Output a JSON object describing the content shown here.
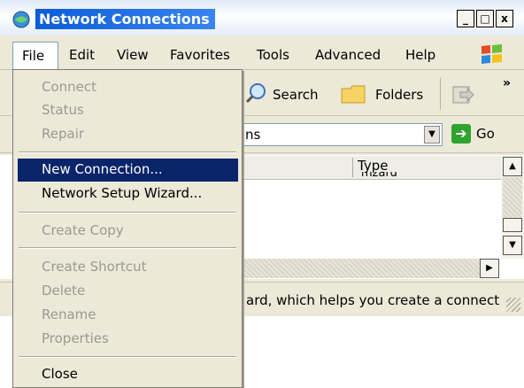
{
  "window": {
    "title": "Network Connections",
    "controls": [
      "_",
      "□",
      "x"
    ]
  },
  "menubar": {
    "items": [
      "File",
      "Edit",
      "View",
      "Favorites",
      "Tools",
      "Advanced",
      "Help"
    ]
  },
  "toolbar": {
    "search_label": "Search",
    "folders_label": "Folders",
    "more": "»"
  },
  "address": {
    "value": "ns",
    "go_label": "Go"
  },
  "list": {
    "column_type": "Type",
    "cell_fragment": "mzard"
  },
  "status": {
    "text": "ard, which helps you create a connect"
  },
  "file_menu": {
    "items": [
      {
        "label": "Connect",
        "enabled": false
      },
      {
        "label": "Status",
        "enabled": false
      },
      {
        "label": "Repair",
        "enabled": false
      },
      {
        "label": "New Connection...",
        "enabled": true,
        "highlighted": true
      },
      {
        "label": "Network Setup Wizard...",
        "enabled": true
      },
      {
        "label": "Create Copy",
        "enabled": false
      },
      {
        "label": "Create Shortcut",
        "enabled": false
      },
      {
        "label": "Delete",
        "enabled": false
      },
      {
        "label": "Rename",
        "enabled": false
      },
      {
        "label": "Properties",
        "enabled": false
      },
      {
        "label": "Close",
        "enabled": true
      }
    ]
  },
  "colors": {
    "highlight": "#0a246a",
    "title_blue": "#0b5dd7",
    "disabled_text": "#9b9a91"
  }
}
